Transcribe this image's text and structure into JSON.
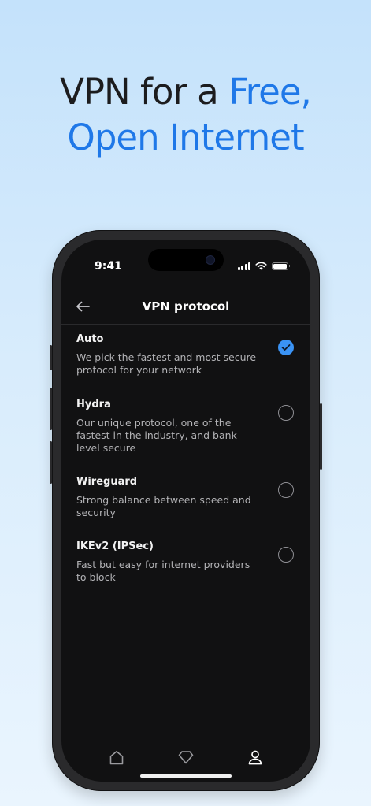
{
  "headline": {
    "part1": "VPN for a ",
    "part2": "Free,",
    "part3": "Open Internet"
  },
  "colors": {
    "accent_blue": "#1f78e8",
    "selected_blue": "#3a93f5",
    "screen_background": "#111112"
  },
  "status_bar": {
    "time": "9:41",
    "icons": [
      "signal-icon",
      "wifi-icon",
      "battery-icon"
    ]
  },
  "header": {
    "title": "VPN protocol",
    "back_icon": "arrow-left-icon"
  },
  "options": [
    {
      "name": "Auto",
      "description": "We pick the fastest and most secure protocol for your network",
      "selected": true
    },
    {
      "name": "Hydra",
      "description": "Our unique protocol, one of the fastest in the industry, and bank-level secure",
      "selected": false
    },
    {
      "name": "Wireguard",
      "description": "Strong balance between speed and security",
      "selected": false
    },
    {
      "name": "IKEv2 (IPSec)",
      "description": "Fast but easy for internet providers to block",
      "selected": false
    }
  ],
  "tab_bar": {
    "tabs": [
      {
        "icon": "home-icon",
        "active": false
      },
      {
        "icon": "diamond-icon",
        "active": false
      },
      {
        "icon": "person-icon",
        "active": true
      }
    ]
  }
}
